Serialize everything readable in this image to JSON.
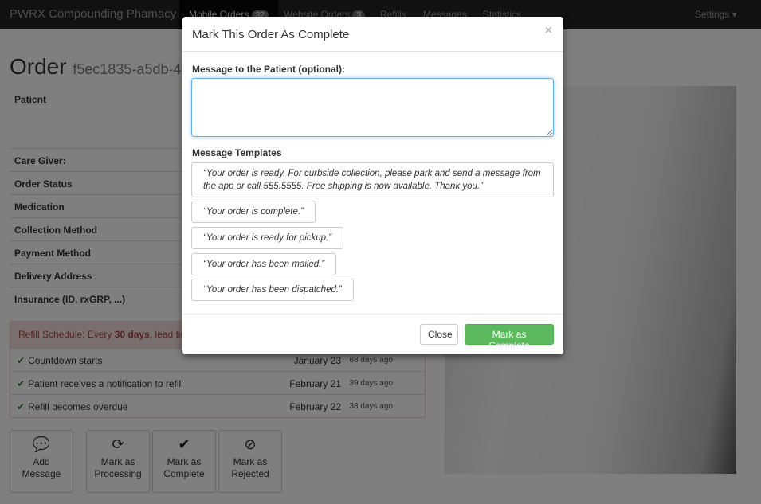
{
  "navbar": {
    "brand": "PWRX Compounding Phamacy",
    "items": [
      {
        "label": "Mobile Orders",
        "badge": "32"
      },
      {
        "label": "Website Orders",
        "badge": "3"
      },
      {
        "label": "Refills"
      },
      {
        "label": "Messages"
      },
      {
        "label": "Statistics"
      }
    ],
    "settings": "Settings ▾"
  },
  "order": {
    "title": "Order",
    "id": "f5ec1835-a5db-4",
    "fields": [
      "Patient",
      "Care Giver:",
      "Order Status",
      "Medication",
      "Collection Method",
      "Payment Method",
      "Delivery Address",
      "Insurance (ID, rxGRP, ...)"
    ]
  },
  "refill": {
    "header_prefix": "Refill Schedule: Every ",
    "days": "30 days",
    "header_suffix": ", lead time",
    "rows": [
      {
        "label": "Countdown starts",
        "date": "January 23",
        "ago": "68 days ago"
      },
      {
        "label": "Patient receives a notification to refill",
        "date": "February 21",
        "ago": "39 days ago"
      },
      {
        "label": "Refill becomes overdue",
        "date": "February 22",
        "ago": "38 days ago"
      }
    ]
  },
  "actions": [
    {
      "icon": "comment-icon",
      "label1": "Add",
      "label2": "Message"
    },
    {
      "icon": "refresh-icon",
      "label1": "Mark as",
      "label2": "Processing"
    },
    {
      "icon": "check-icon",
      "label1": "Mark as",
      "label2": "Complete"
    },
    {
      "icon": "ban-icon",
      "label1": "Mark as",
      "label2": "Rejected"
    }
  ],
  "modal": {
    "title": "Mark This Order As Complete",
    "close": "×",
    "message_label": "Message to the Patient (optional):",
    "message_value": "",
    "templates_label": "Message Templates",
    "templates": [
      "“Your order is ready. For curbside collection, please park and send a message from the app or call 555.5555. Free shipping is now available. Thank you.”",
      "“Your order is complete.”",
      "“Your order is ready for pickup.”",
      "“Your order has been mailed.”",
      "“Your order has been dispatched.”"
    ],
    "close_button": "Close",
    "complete_button": "Mark as Complete"
  },
  "colors": {
    "success": "#5cb85c",
    "danger_bg": "#f2dede",
    "danger_text": "#a94442"
  }
}
